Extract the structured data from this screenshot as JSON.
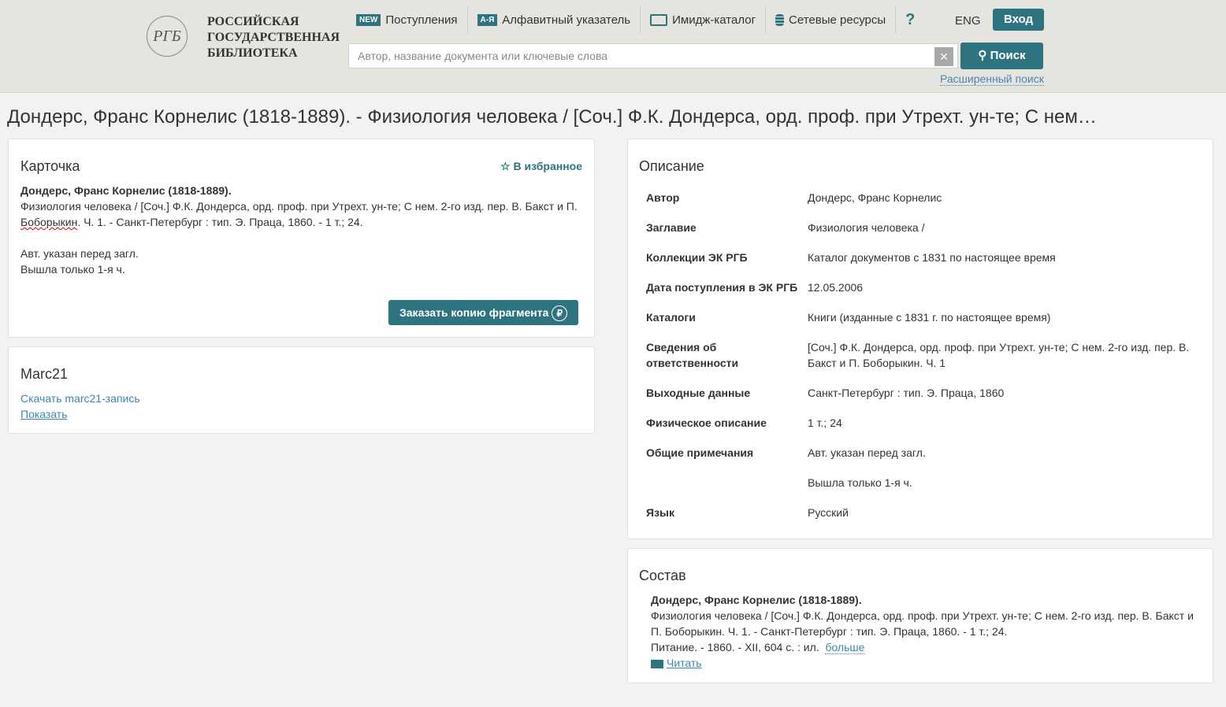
{
  "header": {
    "logo_lines": [
      "РОССИЙСКАЯ",
      "ГОСУДАРСТВЕННАЯ",
      "БИБЛИОТЕКА"
    ],
    "logo_monogram": "РГБ",
    "nav": [
      {
        "badge": "NEW",
        "label": "Поступления"
      },
      {
        "badge": "А-Я",
        "label": "Алфавитный указатель"
      },
      {
        "label": "Имидж-каталог"
      },
      {
        "label": "Сетевые ресурсы"
      }
    ],
    "help": "?",
    "lang": "ENG",
    "login": "Вход",
    "search_placeholder": "Автор, название документа или ключевые слова",
    "search_button": "Поиск",
    "advanced_search": "Расширенный поиск",
    "clear": "×"
  },
  "page_title": "Дондерс, Франс Корнелис (1818-1889). - Физиология человека / [Соч.] Ф.К. Дондерса, орд. проф. при Утрехт. ун-те; С нем…",
  "card": {
    "title": "Карточка",
    "favorite": "В избранное",
    "author": "Дондерс, Франс Корнелис (1818-1889).",
    "body_a": "Физиология человека / [Соч.] Ф.К. Дондерса, орд. проф. при Утрехт. ун-те; С нем. 2-го изд. пер. В. Бакст и П.",
    "body_underlined": "Боборыкин",
    "body_b": ". Ч. 1. - Санкт-Петербург : тип. Э. Праца, 1860. - 1 т.; 24.",
    "note1": "Авт. указан перед загл.",
    "note2": "Вышла только 1-я ч.",
    "order_button": "Заказать копию фрагмента",
    "ruble": "₽"
  },
  "marc": {
    "title": "Marc21",
    "download": "Скачать marc21-запись",
    "show": "Показать"
  },
  "description": {
    "title": "Описание",
    "rows": [
      {
        "k": "Автор",
        "v": "Дондерс, Франс Корнелис"
      },
      {
        "k": "Заглавие",
        "v": "Физиология человека /"
      },
      {
        "k": "Коллекции ЭК РГБ",
        "v": "Каталог документов с 1831 по настоящее время"
      },
      {
        "k": "Дата поступления в ЭК РГБ",
        "v": "12.05.2006"
      },
      {
        "k": "Каталоги",
        "v": "Книги (изданные с 1831 г. по настоящее время)"
      },
      {
        "k": "Сведения об ответственности",
        "v": "[Соч.] Ф.К. Дондерса, орд. проф. при Утрехт. ун-те; С нем. 2-го изд. пер. В. Бакст и П. Боборыкин. Ч. 1"
      },
      {
        "k": "Выходные данные",
        "v": "Санкт-Петербург : тип. Э. Праца, 1860"
      },
      {
        "k": "Физическое описание",
        "v": "1 т.; 24"
      },
      {
        "k": "Общие примечания",
        "v": "Авт. указан перед загл."
      },
      {
        "k": "",
        "v": "Вышла только 1-я ч."
      },
      {
        "k": "Язык",
        "v": "Русский"
      }
    ]
  },
  "contents": {
    "title": "Состав",
    "author": "Дондерс, Франс Корнелис (1818-1889).",
    "body": "Физиология человека / [Соч.] Ф.К. Дондерса, орд. проф. при Утрехт. ун-те; С нем. 2-го изд. пер. В. Бакст и П. Боборыкин. Ч. 1. - Санкт-Петербург : тип. Э. Праца, 1860. - 1 т.; 24.",
    "part": "Питание. - 1860. - XII, 604 с. : ил.",
    "more": "больше",
    "read": "Читать"
  }
}
